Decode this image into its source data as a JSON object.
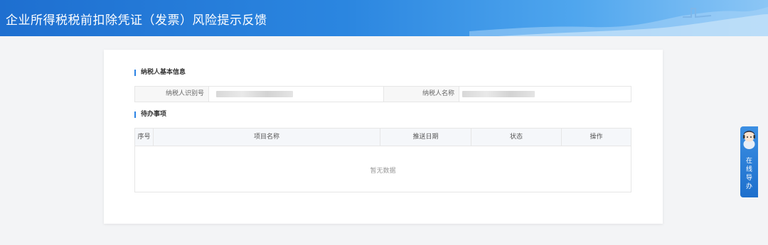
{
  "header": {
    "title": "企业所得税税前扣除凭证（发票）风险提示反馈"
  },
  "basic_info": {
    "section_title": "纳税人基本信息",
    "taxpayer_id_label": "纳税人识别号",
    "taxpayer_name_label": "纳税人名称"
  },
  "todo": {
    "section_title": "待办事项",
    "columns": [
      "序号",
      "项目名称",
      "推送日期",
      "状态",
      "操作"
    ],
    "empty_text": "暂无数据"
  },
  "online_help": {
    "label": "在线导办"
  },
  "colors": {
    "accent": "#2a82e4",
    "header": "#1e6fd0"
  }
}
